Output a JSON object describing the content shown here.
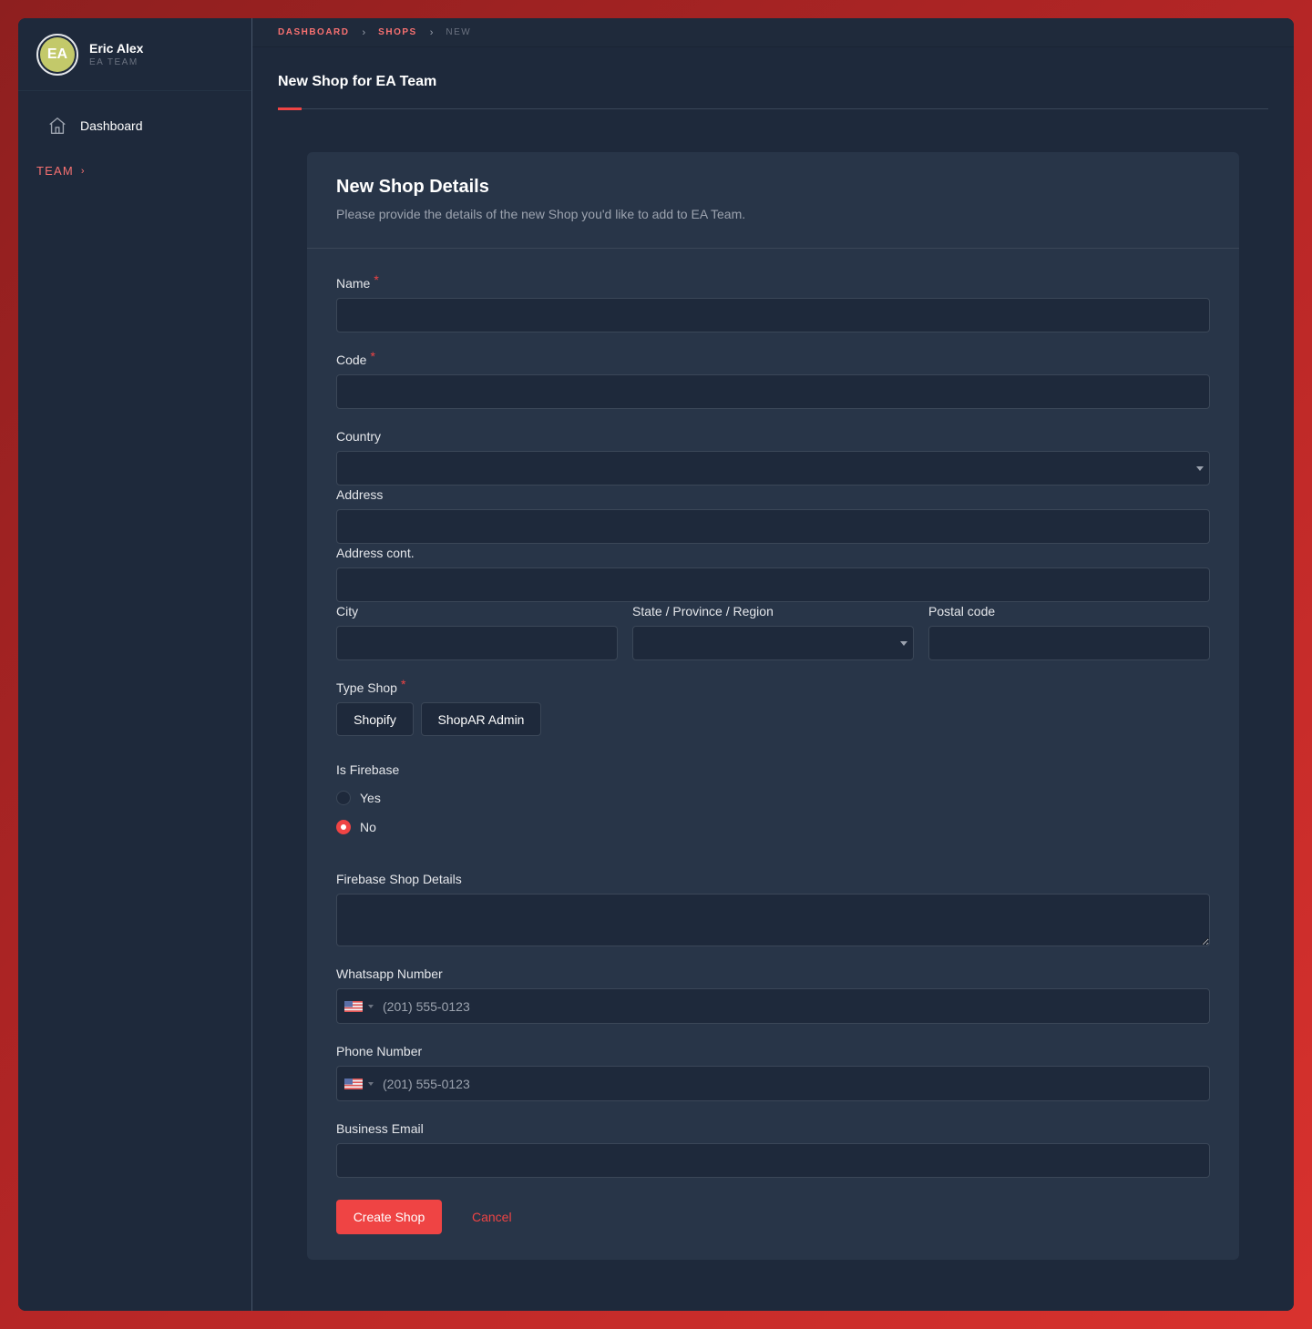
{
  "user": {
    "initials": "EA",
    "name": "Eric Alex",
    "team": "EA TEAM"
  },
  "sidebar": {
    "items": [
      {
        "label": "Dashboard",
        "icon": "home-icon"
      }
    ],
    "section": {
      "label": "TEAM",
      "chevron": "›"
    }
  },
  "breadcrumb": [
    {
      "label": "DASHBOARD"
    },
    {
      "label": "SHOPS"
    },
    {
      "label": "NEW"
    }
  ],
  "breadcrumb_sep": "›",
  "page": {
    "title": "New Shop for EA Team"
  },
  "card": {
    "title": "New Shop Details",
    "subtitle": "Please provide the details of the new Shop you'd like to add to EA Team."
  },
  "form": {
    "name_label": "Name",
    "code_label": "Code",
    "country_label": "Country",
    "address_label": "Address",
    "address_cont_label": "Address cont.",
    "city_label": "City",
    "state_label": "State / Province / Region",
    "postal_label": "Postal code",
    "type_label": "Type Shop",
    "type_options": [
      "Shopify",
      "ShopAR Admin"
    ],
    "firebase_label": "Is Firebase",
    "firebase_options": [
      "Yes",
      "No"
    ],
    "firebase_selected": "No",
    "firebase_details_label": "Firebase Shop Details",
    "whatsapp_label": "Whatsapp Number",
    "whatsapp_placeholder": "(201) 555-0123",
    "phone_label": "Phone Number",
    "phone_placeholder": "(201) 555-0123",
    "email_label": "Business Email",
    "required_mark": "*",
    "submit_label": "Create Shop",
    "cancel_label": "Cancel"
  },
  "colors": {
    "accent": "#ef4444",
    "panel": "#1e293b",
    "card": "#283548",
    "avatar": "#c3c96a"
  }
}
